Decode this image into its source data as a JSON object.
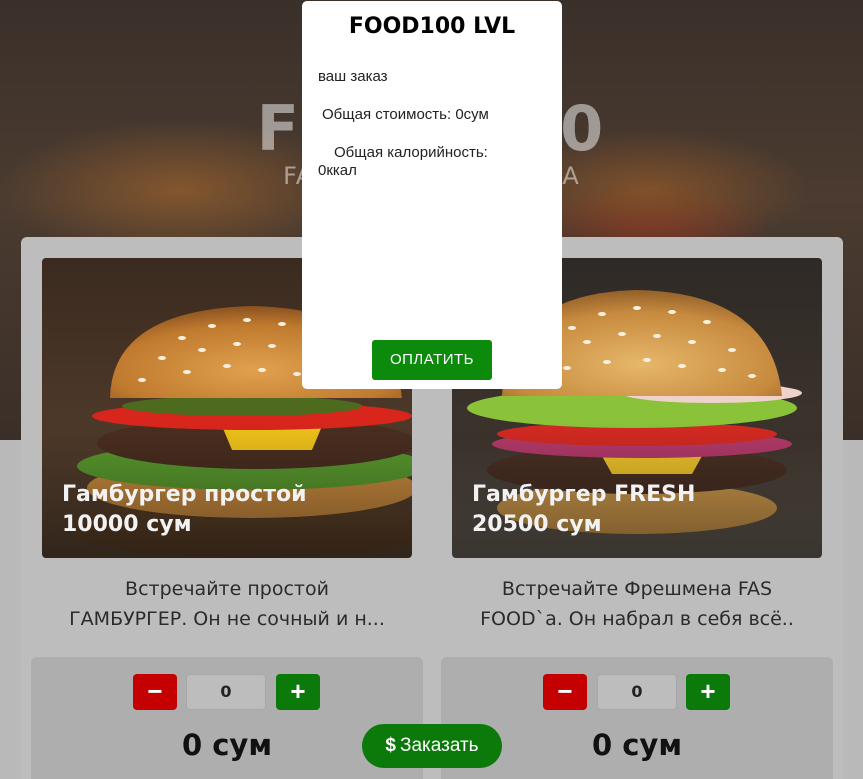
{
  "hero": {
    "title": "FOOD100",
    "subtitle": "FAST FOOD ДОСТАВКА"
  },
  "products": [
    {
      "name_line1": "Гамбургер простой",
      "name_line2": "10000 сум",
      "desc_line1": "Встречайте простой",
      "desc_line2": "ГАМБУРГЕР. Он не сочный и н...",
      "qty": "0",
      "price": "0 сум",
      "minus": "−",
      "plus": "+"
    },
    {
      "name_line1": "Гамбургер FRESH",
      "name_line2": "20500 сум",
      "desc_line1": "Встречайте Фрешмена FAS",
      "desc_line2": "FOOD`а. Он набрал в себя всё..",
      "qty": "0",
      "price": "0 сум",
      "minus": "−",
      "plus": "+"
    }
  ],
  "order_button": {
    "icon": "$",
    "label": "Заказать"
  },
  "modal": {
    "title": "FOOD100 LVL",
    "your_order": "ваш заказ",
    "total_cost": "Общая стоимость: 0сум",
    "total_cal_line1": "Общая калорийность:",
    "total_cal_line2": "0ккал",
    "pay_label": "ОПЛАТИТЬ"
  },
  "colors": {
    "accent_green": "#0b7a0b",
    "minus_red": "#c40000"
  }
}
